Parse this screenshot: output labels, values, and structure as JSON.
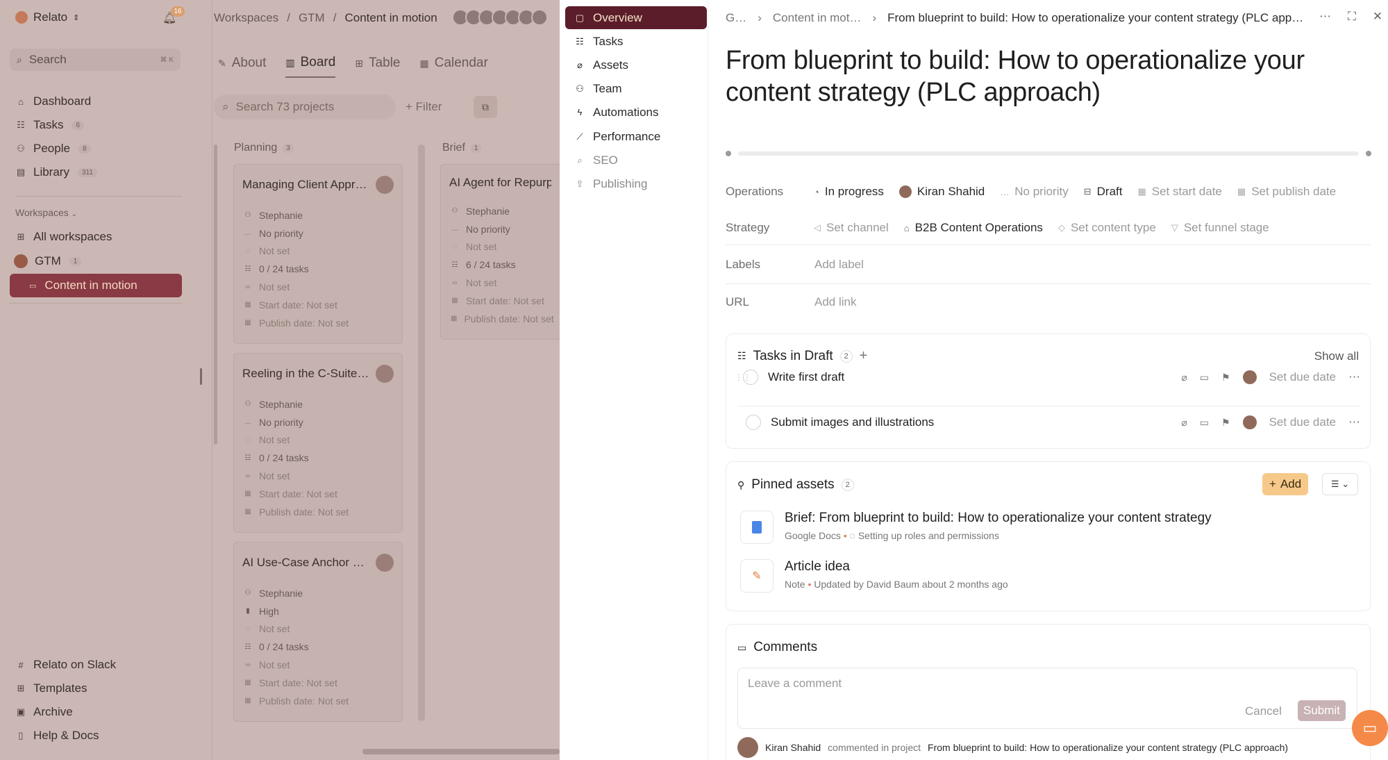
{
  "sidebar": {
    "brand": "Relato",
    "notifications": "16",
    "search": {
      "placeholder": "Search",
      "shortcut": "⌘ K"
    },
    "items": [
      {
        "label": "Dashboard",
        "icon": "dashboard-icon",
        "count": ""
      },
      {
        "label": "Tasks",
        "icon": "tasks-icon",
        "count": "6"
      },
      {
        "label": "People",
        "icon": "people-icon",
        "count": "8"
      },
      {
        "label": "Library",
        "icon": "library-icon",
        "count": "311"
      }
    ],
    "workspaces_label": "Workspaces",
    "all_workspaces": "All workspaces",
    "gtm": {
      "label": "GTM",
      "count": "1"
    },
    "active": "Content in motion",
    "footer": [
      {
        "label": "Relato on Slack"
      },
      {
        "label": "Templates"
      },
      {
        "label": "Archive"
      },
      {
        "label": "Help & Docs"
      }
    ]
  },
  "board": {
    "breadcrumb": [
      "Workspaces",
      "GTM",
      "Content in motion"
    ],
    "tabs": [
      "About",
      "Board",
      "Table",
      "Calendar"
    ],
    "search_placeholder": "Search 73 projects",
    "filter": "Filter",
    "columns": [
      {
        "name": "Planning",
        "count": "3"
      },
      {
        "name": "Brief",
        "count": "1"
      }
    ],
    "cards": [
      {
        "title": "Managing Client Appr…",
        "owner": "Stephanie",
        "priority": "No priority",
        "status": "Not set",
        "tasks": "0 / 24 tasks",
        "link": "Not set",
        "start": "Start date: Not set",
        "publish": "Publish date: Not set"
      },
      {
        "title": "Reeling in the C-Suite …",
        "owner": "Stephanie",
        "priority": "No priority",
        "status": "Not set",
        "tasks": "0 / 24 tasks",
        "link": "Not set",
        "start": "Start date: Not set",
        "publish": "Publish date: Not set"
      },
      {
        "title": "AI Use-Case Anchor B…",
        "owner": "Stephanie",
        "priority": "High",
        "status": "Not set",
        "tasks": "0 / 24 tasks",
        "link": "Not set",
        "start": "Start date: Not set",
        "publish": "Publish date: Not set"
      },
      {
        "title": "AI Agent for Repurpo",
        "owner": "Stephanie",
        "priority": "No priority",
        "status": "Not set",
        "tasks": "6 / 24 tasks",
        "link": "Not set",
        "start": "Start date: Not set",
        "publish": "Publish date: Not set"
      }
    ]
  },
  "project_nav": {
    "items": [
      "Overview",
      "Tasks",
      "Assets",
      "Team",
      "Automations",
      "Performance",
      "SEO",
      "Publishing"
    ]
  },
  "detail": {
    "breadcrumb": [
      "G…",
      "Content in mot…",
      "From blueprint to build: How to operationalize your content strategy (PLC app…"
    ],
    "title": "From blueprint to build: How to operationalize your content strategy (PLC approach)",
    "operations": {
      "label": "Operations",
      "status": "In progress",
      "owner": "Kiran Shahid",
      "priority": "No priority",
      "stage": "Draft",
      "start": "Set start date",
      "publish": "Set publish date"
    },
    "strategy": {
      "label": "Strategy",
      "channel": "Set channel",
      "team": "B2B Content Operations",
      "content_type": "Set content type",
      "funnel": "Set funnel stage"
    },
    "labels": {
      "label": "Labels",
      "value": "Add label"
    },
    "url": {
      "label": "URL",
      "value": "Add link"
    },
    "tasks": {
      "title": "Tasks in Draft",
      "count": "2",
      "show_all": "Show all",
      "items": [
        {
          "name": "Write first draft",
          "due": "Set due date"
        },
        {
          "name": "Submit images and illustrations",
          "due": "Set due date"
        }
      ]
    },
    "assets": {
      "title": "Pinned assets",
      "count": "2",
      "add": "Add",
      "items": [
        {
          "title": "Brief: From blueprint to build: How to operationalize your content strategy",
          "source": "Google Docs",
          "meta": "Setting up roles and permissions"
        },
        {
          "title": "Article idea",
          "source": "Note",
          "meta": "Updated by David Baum about 2 months ago"
        }
      ]
    },
    "comments": {
      "title": "Comments",
      "placeholder": "Leave a comment",
      "cancel": "Cancel",
      "submit": "Submit",
      "activity": {
        "author": "Kiran Shahid",
        "verb": "commented in project",
        "project": "From blueprint to build: How to operationalize your content strategy (PLC approach)"
      }
    }
  },
  "colors": {
    "accent": "#5c1d2a",
    "add_button": "#f6c98a",
    "chat": "#f58a48"
  }
}
